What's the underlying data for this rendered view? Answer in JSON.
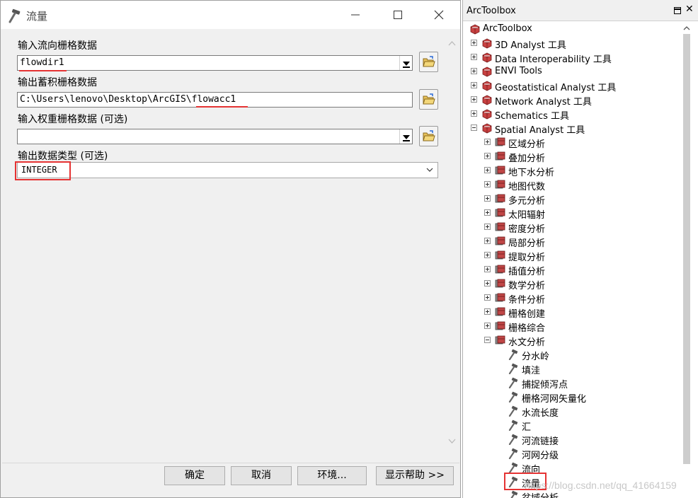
{
  "dialog": {
    "title": "流量",
    "params": {
      "in_flowdir_label": "输入流向栅格数据",
      "in_flowdir_value": "flowdir1",
      "out_accum_label": "输出蓄积栅格数据",
      "out_accum_value": "C:\\Users\\lenovo\\Desktop\\ArcGIS\\flowacc1",
      "in_weight_label": "输入权重栅格数据 (可选)",
      "in_weight_value": "",
      "data_type_label": "输出数据类型 (可选)",
      "data_type_value": "INTEGER"
    },
    "buttons": {
      "ok": "确定",
      "cancel": "取消",
      "env": "环境...",
      "help": "显示帮助 >>"
    }
  },
  "toolbox": {
    "title": "ArcToolbox",
    "root": "ArcToolbox",
    "toolsets": [
      "3D Analyst 工具",
      "Data Interoperability 工具",
      "ENVI Tools",
      "Geostatistical Analyst 工具",
      "Network Analyst 工具",
      "Schematics 工具",
      "Spatial Analyst 工具"
    ],
    "spatial_toolsets": [
      "区域分析",
      "叠加分析",
      "地下水分析",
      "地图代数",
      "多元分析",
      "太阳辐射",
      "密度分析",
      "局部分析",
      "提取分析",
      "插值分析",
      "数学分析",
      "条件分析",
      "栅格创建",
      "栅格综合",
      "水文分析"
    ],
    "hydrology_tools": [
      "分水岭",
      "填洼",
      "捕捉倾泻点",
      "栅格河网矢量化",
      "水流长度",
      "汇",
      "河流链接",
      "河网分级",
      "流向",
      "流量",
      "盆域分析"
    ]
  },
  "watermark": "https://blog.csdn.net/qq_41664159",
  "colors": {
    "highlight": "#e53333",
    "toolbox_red": "#b52d2d"
  }
}
